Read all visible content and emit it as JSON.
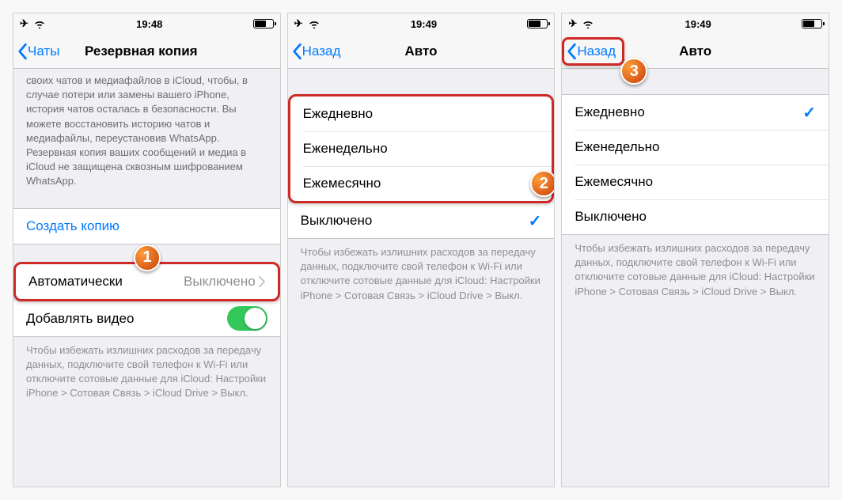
{
  "phone1": {
    "time": "19:48",
    "back": "Чаты",
    "title": "Резервная копия",
    "header_text": "своих чатов и медиафайлов в iCloud, чтобы, в случае потери или замены вашего iPhone, история чатов осталась в безопасности. Вы можете восстановить историю чатов и медиафайлы, переустановив WhatsApp. Резервная копия ваших сообщений и медиа в iCloud не защищена сквозным шифрованием WhatsApp.",
    "create_label": "Создать копию",
    "auto_label": "Автоматически",
    "auto_value": "Выключено",
    "video_label": "Добавлять видео",
    "footer_text": "Чтобы избежать излишних расходов за передачу данных, подключите свой телефон к Wi-Fi или отключите сотовые данные для iCloud: Настройки iPhone > Сотовая Связь > iCloud Drive > Выкл.",
    "step": "1"
  },
  "phone2": {
    "time": "19:49",
    "back": "Назад",
    "title": "Авто",
    "options": [
      "Ежедневно",
      "Еженедельно",
      "Ежемесячно"
    ],
    "off_label": "Выключено",
    "footer_text": "Чтобы избежать излишних расходов за передачу данных, подключите свой телефон к Wi-Fi или отключите сотовые данные для iCloud: Настройки iPhone > Сотовая Связь > iCloud Drive > Выкл.",
    "step": "2"
  },
  "phone3": {
    "time": "19:49",
    "back": "Назад",
    "title": "Авто",
    "options": [
      "Ежедневно",
      "Еженедельно",
      "Ежемесячно"
    ],
    "selected_index": 0,
    "off_label": "Выключено",
    "footer_text": "Чтобы избежать излишних расходов за передачу данных, подключите свой телефон к Wi-Fi или отключите сотовые данные для iCloud: Настройки iPhone > Сотовая Связь > iCloud Drive > Выкл.",
    "step": "3"
  }
}
